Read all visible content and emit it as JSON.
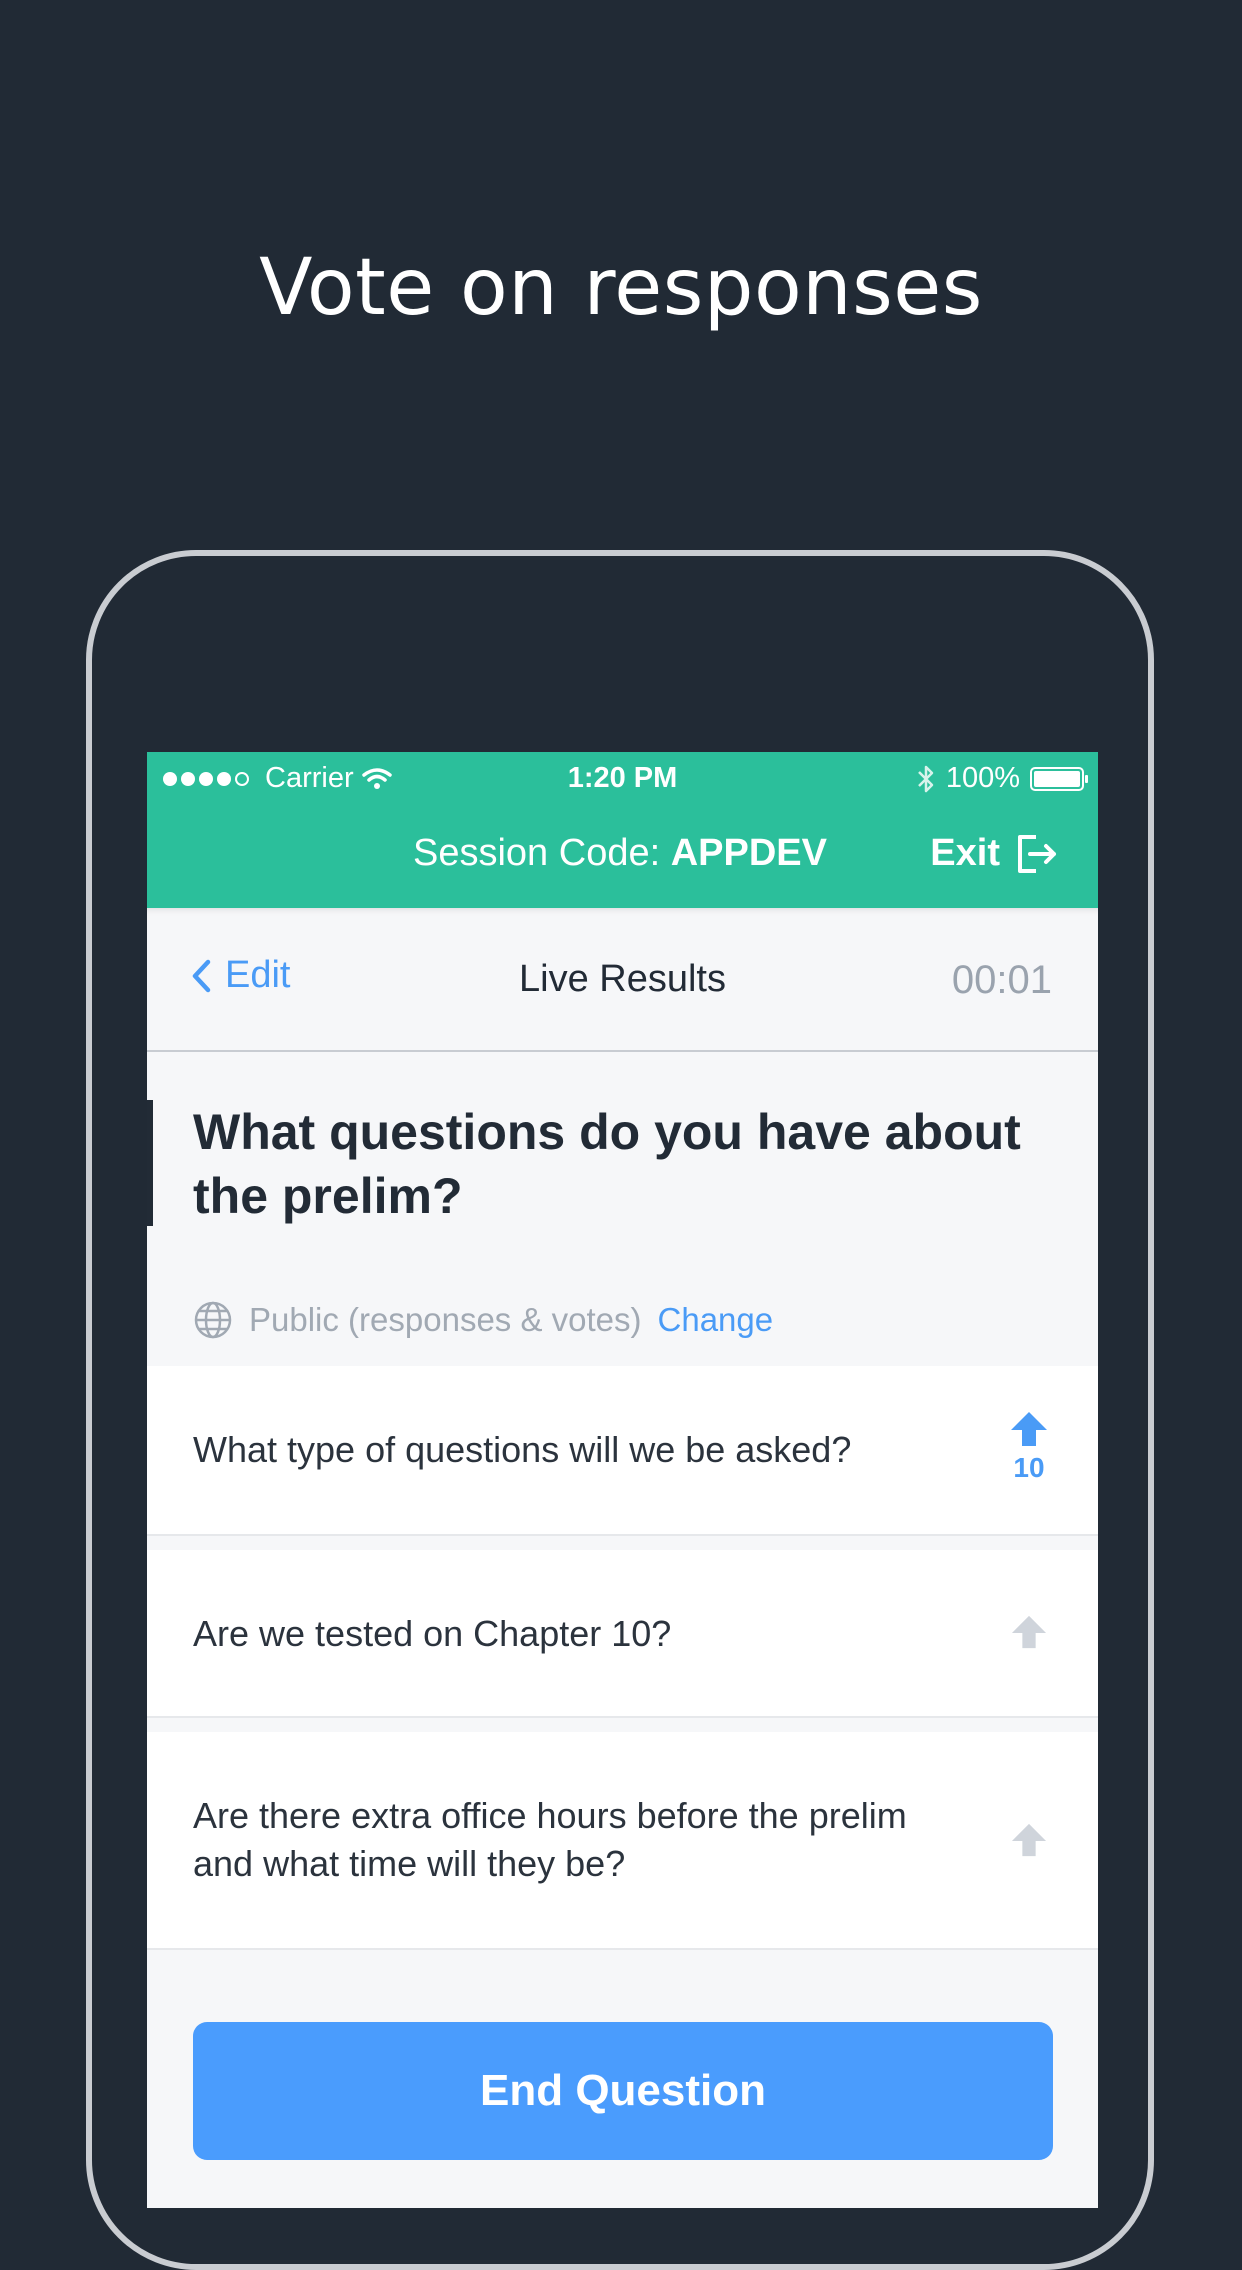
{
  "headline": "Vote on responses",
  "status_bar": {
    "carrier": "Carrier",
    "time": "1:20 PM",
    "battery": "100%"
  },
  "session_bar": {
    "label": "Session Code:",
    "code": "APPDEV",
    "exit_label": "Exit"
  },
  "nav": {
    "back_label": "Edit",
    "title": "Live Results",
    "timer": "00:01"
  },
  "question": "What questions do you have about the prelim?",
  "privacy": {
    "label": "Public (responses & votes)",
    "change_label": "Change"
  },
  "responses": [
    {
      "text": "What type of questions will we be asked?",
      "votes": "10",
      "upvoted": true
    },
    {
      "text": "Are we tested on Chapter 10?",
      "votes": "",
      "upvoted": false
    },
    {
      "text": "Are there extra office hours before the prelim and what time will they be?",
      "votes": "",
      "upvoted": false
    }
  ],
  "end_button": "End Question",
  "colors": {
    "background": "#212a35",
    "header_green": "#2bbf9b",
    "accent_blue": "#4a9bf6",
    "upvote_inactive": "#cfd4db"
  }
}
